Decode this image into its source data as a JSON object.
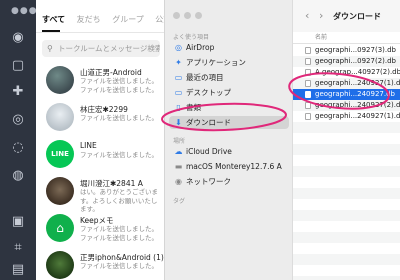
{
  "line_app": {
    "tabs": [
      "すべて",
      "友だち",
      "グループ",
      "公式アカウント"
    ],
    "search_placeholder": "トークルームとメッセージ検索",
    "chats": [
      {
        "name": "山道正男-Android",
        "preview": "ファイルを送信しました。ファイルを送信しました。"
      },
      {
        "name": "林庄宏✱2299",
        "preview": "ファイルを送信しました。"
      },
      {
        "name": "LINE",
        "preview": "ファイルを送信しました。"
      },
      {
        "name": "堀川澄江✱2841 A",
        "preview": "はい。ありがとうございます。よろしくお願いいたします。"
      },
      {
        "name": "Keepメモ",
        "preview": "ファイルを送信しました。ファイルを送信しました。"
      },
      {
        "name": "正男iphon&Android (1)",
        "preview": "ファイルを送信しました。"
      }
    ],
    "line_avatar_text": "LINE"
  },
  "finder": {
    "title": "ダウンロード",
    "sidebar": {
      "favorites_header": "よく使う項目",
      "favorites": [
        {
          "label": "AirDrop",
          "icon": "airdrop-icon"
        },
        {
          "label": "アプリケーション",
          "icon": "applications-icon"
        },
        {
          "label": "最近の項目",
          "icon": "recents-icon"
        },
        {
          "label": "デスクトップ",
          "icon": "desktop-icon"
        },
        {
          "label": "書類",
          "icon": "documents-icon"
        },
        {
          "label": "ダウンロード",
          "icon": "downloads-icon"
        }
      ],
      "locations_header": "場所",
      "locations": [
        {
          "label": "iCloud Drive",
          "icon": "cloud-icon"
        },
        {
          "label": "macOS Monterey12.7.6 A",
          "icon": "disk-icon"
        },
        {
          "label": "ネットワーク",
          "icon": "network-icon"
        }
      ],
      "tags_header": "タグ"
    },
    "column_header": "名前",
    "files": [
      {
        "name": "geographi...0927(3).db",
        "selected": false
      },
      {
        "name": "geographi...0927(2).db",
        "selected": false
      },
      {
        "name": "A geograp...40927(2).db",
        "selected": false
      },
      {
        "name": "geographi...240927(1).db",
        "selected": false
      },
      {
        "name": "geographi...240927.db",
        "selected": true
      },
      {
        "name": "geographi...240927(2).db",
        "selected": false
      },
      {
        "name": "geographi...240927(1).db",
        "selected": false
      }
    ]
  },
  "colors": {
    "accent_blue": "#1f6ee8",
    "annotation_magenta": "#e0287a",
    "line_green": "#06c755"
  }
}
